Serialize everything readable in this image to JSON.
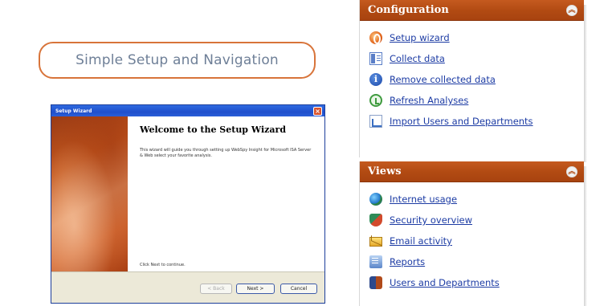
{
  "caption": "Simple Setup and Navigation",
  "wizard": {
    "window_title": "Setup Wizard",
    "heading": "Welcome to the Setup Wizard",
    "body": "This wizard will guide you through setting up WebSpy Insight for Microsoft ISA Server & Web select your favorite analysis.",
    "continue_text": "Click Next to continue.",
    "buttons": {
      "back": "< Back",
      "next": "Next >",
      "cancel": "Cancel"
    }
  },
  "configuration": {
    "title": "Configuration",
    "items": [
      {
        "label": "Setup wizard",
        "icon": "setup-wizard-icon"
      },
      {
        "label": "Collect data",
        "icon": "collect-data-icon"
      },
      {
        "label": "Remove collected data",
        "icon": "info-icon"
      },
      {
        "label": "Refresh Analyses",
        "icon": "refresh-icon"
      },
      {
        "label": "Import Users and Departments",
        "icon": "import-icon"
      }
    ]
  },
  "views": {
    "title": "Views",
    "items": [
      {
        "label": "Internet usage",
        "icon": "globe-icon"
      },
      {
        "label": "Security overview",
        "icon": "shield-icon"
      },
      {
        "label": "Email activity",
        "icon": "mail-icon"
      },
      {
        "label": "Reports",
        "icon": "reports-icon"
      },
      {
        "label": "Users and Departments",
        "icon": "users-icon"
      }
    ]
  },
  "colors": {
    "accent": "#b14a12",
    "link": "#1d3ca4",
    "caption_border": "#d8743a",
    "caption_text": "#6e7f97"
  }
}
